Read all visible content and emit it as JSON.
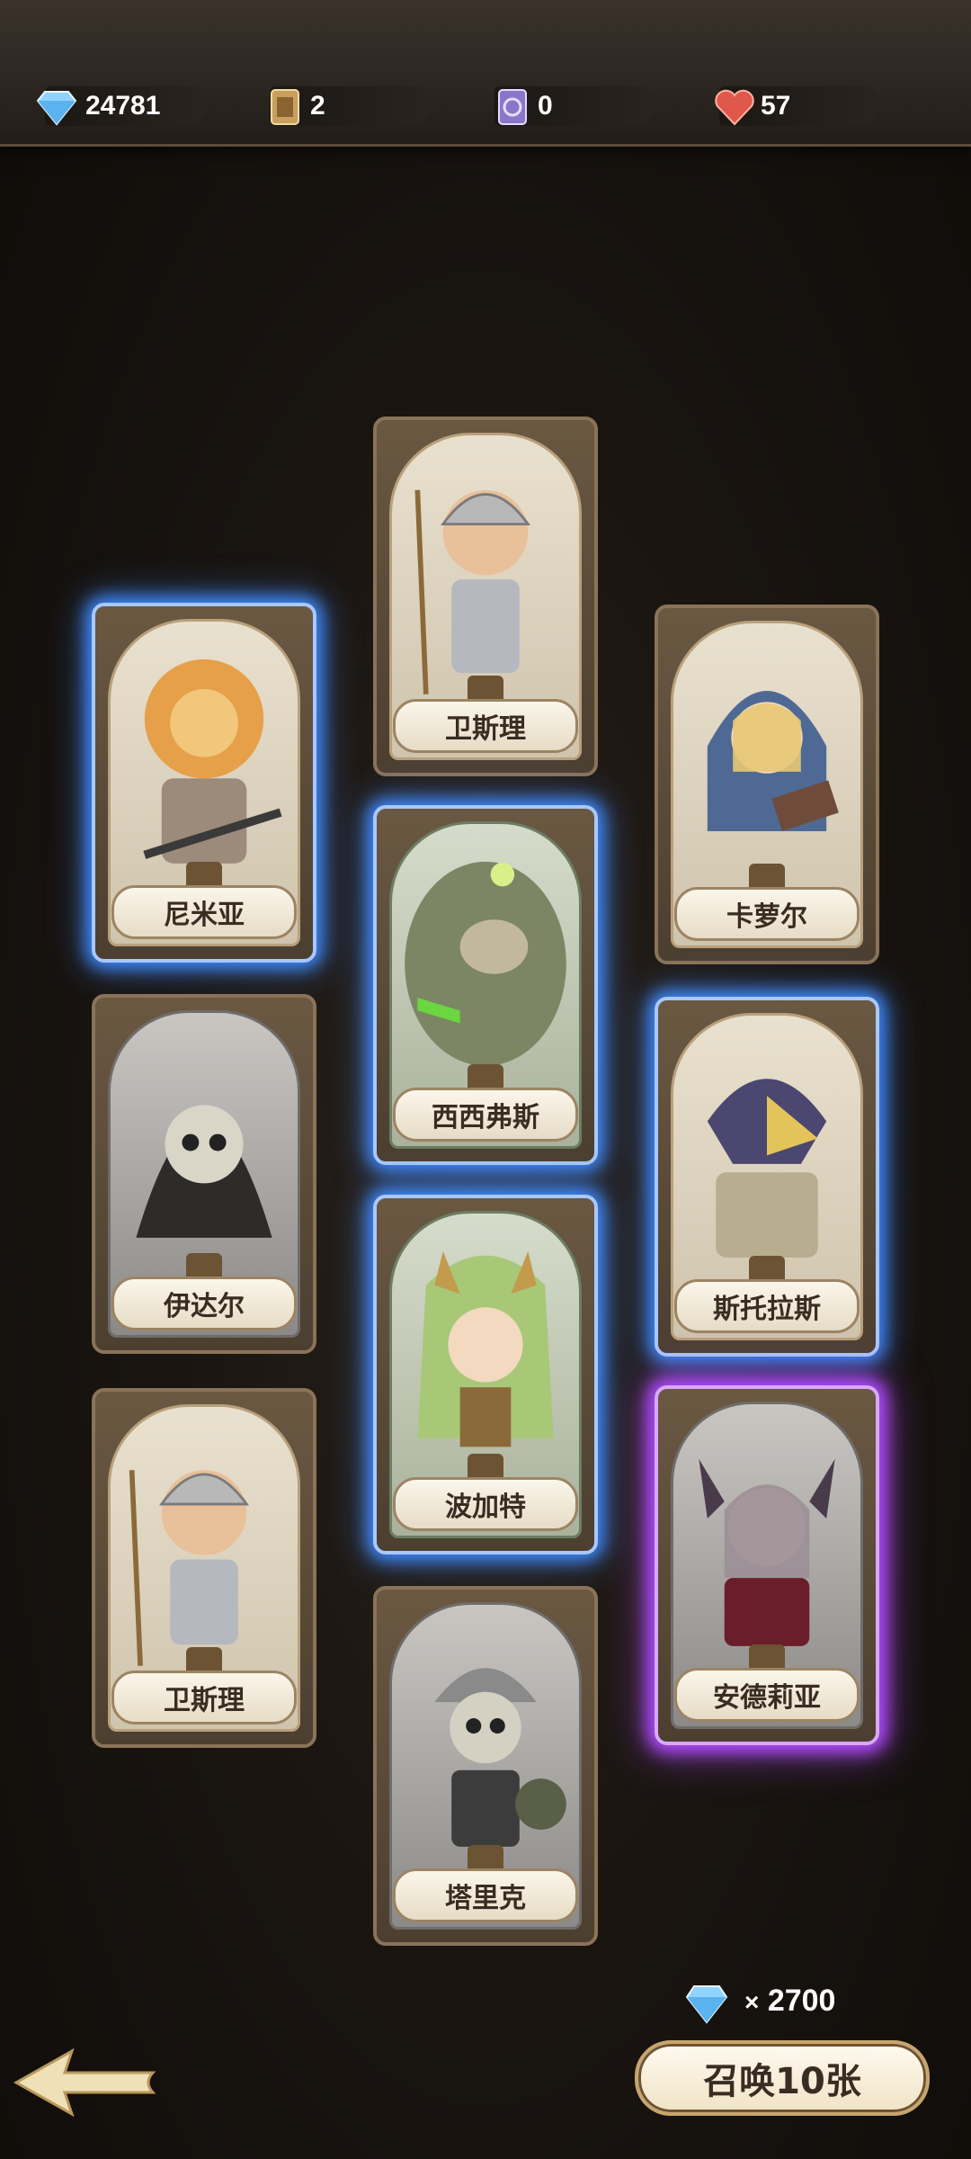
{
  "resources": [
    {
      "icon": "diamond-icon",
      "value": "24781"
    },
    {
      "icon": "scroll-icon",
      "value": "2"
    },
    {
      "icon": "purple-ticket-icon",
      "value": "0"
    },
    {
      "icon": "heart-icon",
      "value": "57"
    }
  ],
  "cards": [
    {
      "name": "卫斯理",
      "rarity": "normal"
    },
    {
      "name": "尼米亚",
      "rarity": "blue"
    },
    {
      "name": "卡萝尔",
      "rarity": "normal"
    },
    {
      "name": "西西弗斯",
      "rarity": "blue"
    },
    {
      "name": "伊达尔",
      "rarity": "normal"
    },
    {
      "name": "斯托拉斯",
      "rarity": "blue"
    },
    {
      "name": "波加特",
      "rarity": "blue"
    },
    {
      "name": "卫斯理",
      "rarity": "normal"
    },
    {
      "name": "安德莉亚",
      "rarity": "purple"
    },
    {
      "name": "塔里克",
      "rarity": "normal"
    }
  ],
  "summon": {
    "cost_prefix": "×",
    "cost_value": "2700",
    "button_label": "召唤10张"
  }
}
